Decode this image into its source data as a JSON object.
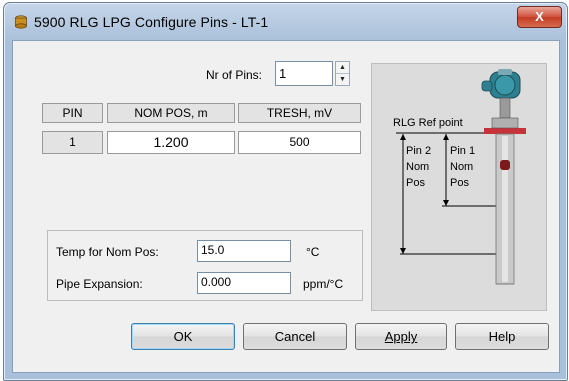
{
  "window": {
    "title": "5900 RLG LPG Configure Pins - LT-1",
    "close_icon": "close-icon",
    "close_glyph": "X"
  },
  "pins": {
    "label": "Nr of Pins:",
    "value": "1"
  },
  "table": {
    "headers": [
      "PIN",
      "NOM POS, m",
      "TRESH, mV"
    ],
    "rows": [
      {
        "pin": "1",
        "nom_pos": "1.200",
        "tresh": "500"
      }
    ]
  },
  "temp": {
    "label": "Temp for Nom Pos:",
    "value": "15.0",
    "unit": "°C"
  },
  "pipe": {
    "label": "Pipe Expansion:",
    "value": "0.000",
    "unit": "ppm/°C"
  },
  "diagram": {
    "ref_label": "RLG Ref point",
    "pin2_lines": [
      "Pin 2",
      "Nom",
      "Pos"
    ],
    "pin1_lines": [
      "Pin 1",
      "Nom",
      "Pos"
    ]
  },
  "buttons": {
    "ok": "OK",
    "cancel": "Cancel",
    "apply": "Apply",
    "help": "Help"
  }
}
